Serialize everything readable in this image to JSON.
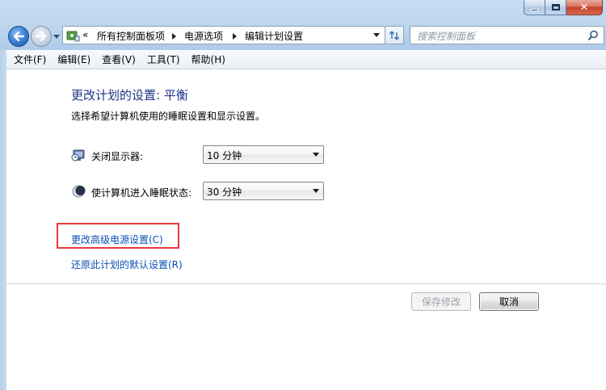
{
  "window": {
    "caption_buttons": {
      "minimize_icon": "minimize-icon",
      "maximize_icon": "maximize-icon",
      "close_glyph": "✕"
    }
  },
  "navigation": {
    "back_icon": "back-arrow-icon",
    "forward_icon": "forward-arrow-icon",
    "address": {
      "overflow": "«",
      "breadcrumbs": [
        "所有控制面板项",
        "电源选项",
        "编辑计划设置"
      ]
    },
    "search": {
      "placeholder": "搜索控制面板"
    }
  },
  "menu": {
    "items": [
      "文件(F)",
      "编辑(E)",
      "查看(V)",
      "工具(T)",
      "帮助(H)"
    ]
  },
  "main": {
    "title": "更改计划的设置: 平衡",
    "subtitle": "选择希望计算机使用的睡眠设置和显示设置。",
    "settings": [
      {
        "label": "关闭显示器:",
        "value": "10 分钟",
        "icon": "monitor-clock-icon"
      },
      {
        "label": "使计算机进入睡眠状态:",
        "value": "30 分钟",
        "icon": "moon-sleep-icon"
      }
    ],
    "links": {
      "advanced": "更改高级电源设置(C)",
      "restore": "还原此计划的默认设置(R)"
    },
    "highlight_color": "#e83a3a",
    "buttons": {
      "save": "保存修改",
      "cancel": "取消"
    }
  },
  "colors": {
    "title": "#1e3287",
    "link": "#0a4fb5",
    "frame": "#bcd5ee"
  }
}
